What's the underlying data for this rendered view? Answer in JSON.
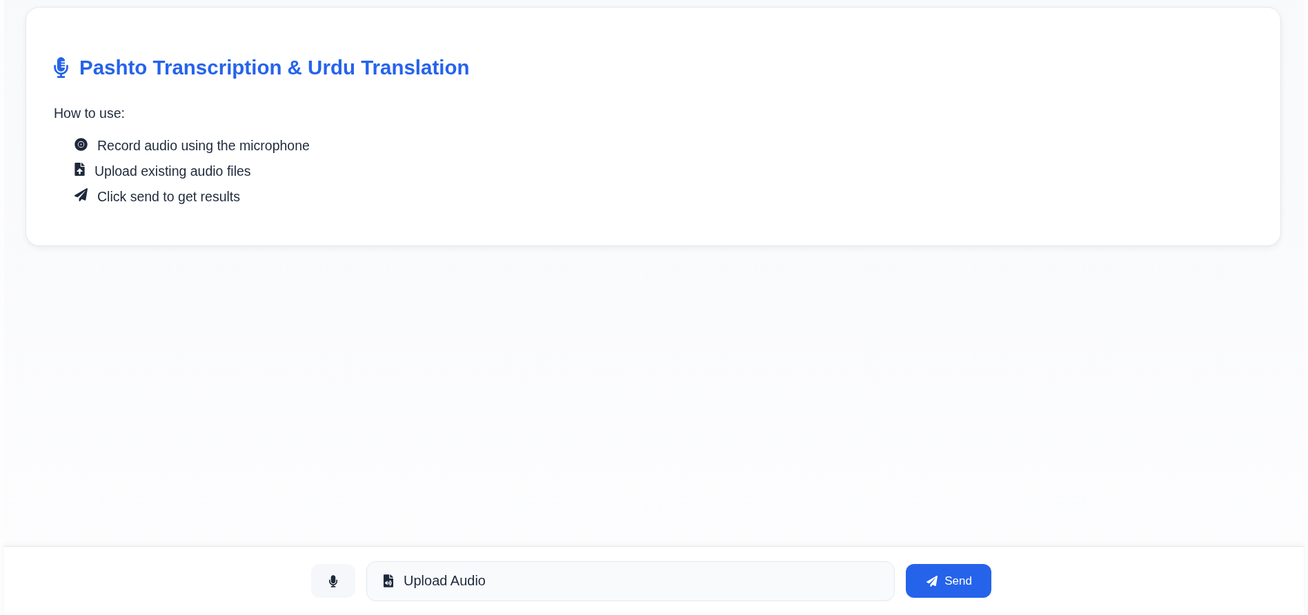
{
  "header": {
    "title": "Pashto Transcription & Urdu Translation"
  },
  "instructions": {
    "heading": "How to use:",
    "steps": [
      {
        "kind": "record",
        "text": "Record audio using the microphone"
      },
      {
        "kind": "upload",
        "text": "Upload existing audio files"
      },
      {
        "kind": "send",
        "text": "Click send to get results"
      }
    ]
  },
  "input_bar": {
    "upload_label": "Upload Audio",
    "send_label": "Send"
  }
}
